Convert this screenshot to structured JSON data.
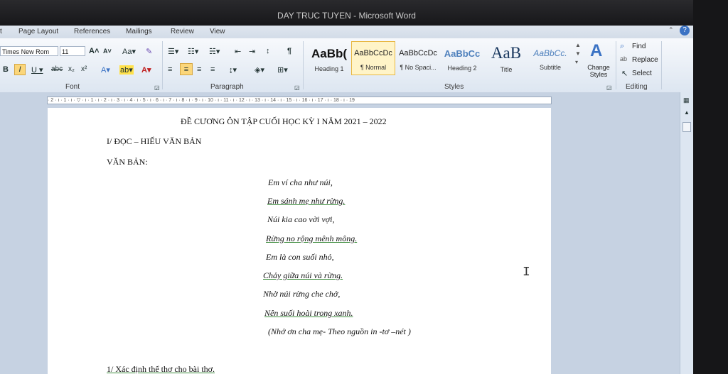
{
  "window": {
    "title": "DAY TRUC TUYEN  -  Microsoft Word"
  },
  "tabs": [
    "t",
    "Page Layout",
    "References",
    "Mailings",
    "Review",
    "View"
  ],
  "font": {
    "name": "Times New Rom",
    "size": "11",
    "group_label": "Font"
  },
  "paragraph": {
    "group_label": "Paragraph"
  },
  "styles": {
    "group_label": "Styles",
    "items": [
      {
        "sample": "AaBb(",
        "name": "Heading 1"
      },
      {
        "sample": "AaBbCcDc",
        "name": "¶ Normal"
      },
      {
        "sample": "AaBbCcDc",
        "name": "¶ No Spaci..."
      },
      {
        "sample": "AaBbCc",
        "name": "Heading 2"
      },
      {
        "sample": "AaB",
        "name": "Title"
      },
      {
        "sample": "AaBbCc.",
        "name": "Subtitle"
      }
    ],
    "change_styles": "Change Styles"
  },
  "editing": {
    "group_label": "Editing",
    "find": "Find",
    "replace": "Replace",
    "select": "Select"
  },
  "ruler": {
    "text": "· 2 · ı · 1 · ı · ▽ · ı · 1 · ı · 2 · ı · 3 · ı · 4 · ı · 5 · ı · 6 · ı · 7 · ı · 8 · ı · 9 · ı · 10 · ı · 11 · ı · 12 · ı · 13 · ı · 14 · ı · 15 · ı · 16 · ı · 17 · ı · 18 · ı · 19"
  },
  "document": {
    "title": "ĐỀ CƯƠNG  ÔN TẬP CUỐI HỌC KỲ I NĂM 2021 – 2022",
    "section1": "I/ ĐỌC – HIỂU VĂN BẢN",
    "vanban": "VĂN BẢN:",
    "poem": [
      "Em ví cha như núi,",
      "Em sánh mẹ như rừng.",
      "Núi kia cao vời vợi,",
      "Rừng no rộng mênh mông.",
      "Em là con suối nhỏ,",
      "Chảy giữa núi và rừng.",
      "Nhờ núi rừng che chở,",
      "Nên suối hoài trong xanh."
    ],
    "source": "(Nhớ ơn cha mẹ- Theo nguồn in -tơ –nét )",
    "question1": "1/ Xác định thể thơ cho bài thơ."
  }
}
